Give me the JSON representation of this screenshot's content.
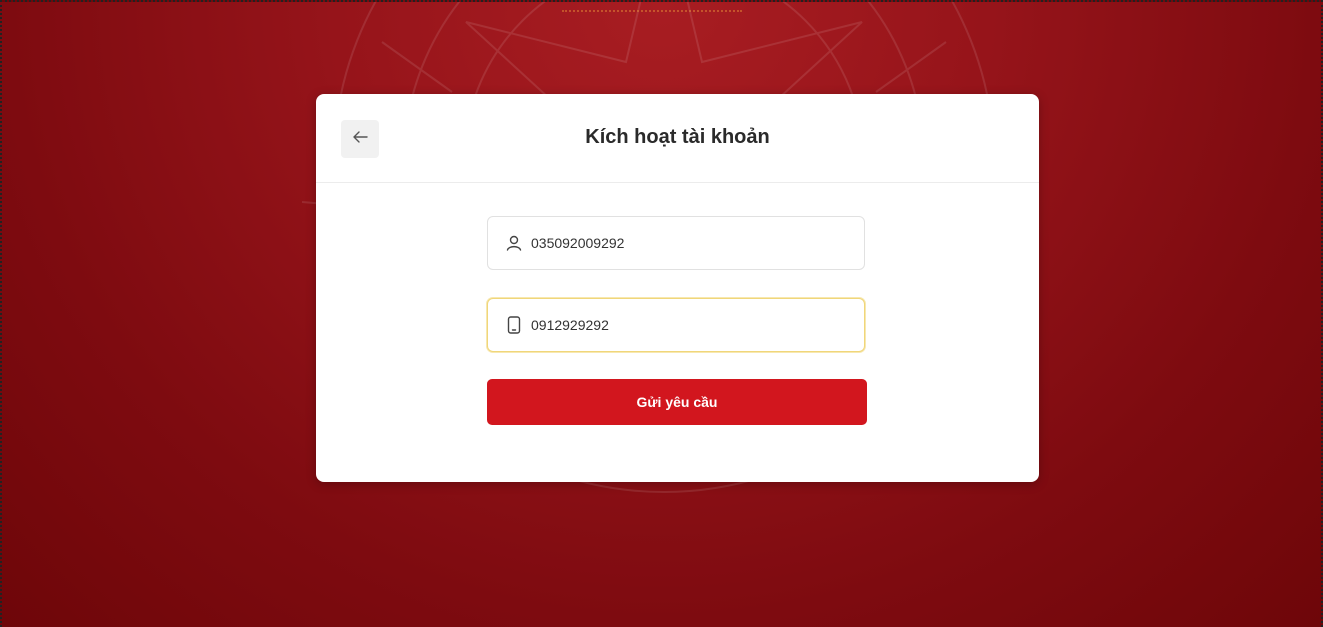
{
  "card": {
    "title": "Kích hoạt tài khoản",
    "back_icon": "arrow-left-icon"
  },
  "form": {
    "id_field": {
      "icon": "user-icon",
      "value": "035092009292"
    },
    "phone_field": {
      "icon": "mobile-phone-icon",
      "value": "0912929292"
    },
    "submit_label": "Gửi yêu cầu"
  },
  "colors": {
    "background": "#8e1015",
    "primary_button": "#d2161e",
    "focus_border": "#f0d67a"
  }
}
